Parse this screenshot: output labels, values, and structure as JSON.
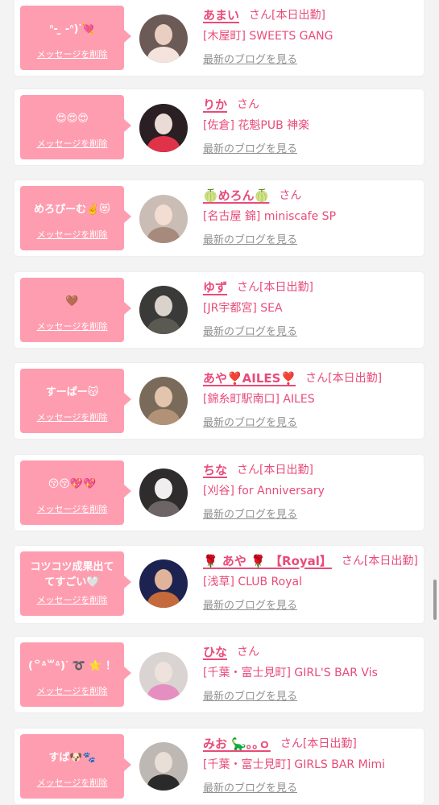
{
  "delete_label": "メッセージを削除",
  "san_label": "さん",
  "blog_label": "最新のブログを見る",
  "colors": {
    "accent": "#e84b7a",
    "bubble": "#ff9db0",
    "link_gray": "#909090"
  },
  "entries": [
    {
      "message": "ᐢ- ̫ -ᐢ)ᐝ💘",
      "name": "あまい",
      "status": "[本日出勤]",
      "shop": "[木屋町] SWEETS GANG",
      "avatar_colors": [
        "#6b5a55",
        "#e9cfc2",
        "#f4e3dc"
      ]
    },
    {
      "message": "😍😍😍",
      "name": "りか",
      "status": "",
      "shop": "[佐倉] 花魁PUB 神楽",
      "avatar_colors": [
        "#2a1f22",
        "#eadbd7",
        "#e0334a"
      ]
    },
    {
      "message": "めろぴーむ✌️😻",
      "name": "🍈めろん🍈",
      "status": "",
      "shop": "[名古屋 錦] miniscafe SP",
      "avatar_colors": [
        "#c9bdb5",
        "#f3dcd2",
        "#a78a7c"
      ]
    },
    {
      "message": "🤎",
      "name": "ゆず",
      "status": "[本日出勤]",
      "shop": "[JR宇都宮] SEA",
      "avatar_colors": [
        "#3a3a38",
        "#d9d3cc",
        "#5b5a52"
      ]
    },
    {
      "message": "すーぱー😽",
      "name": "あや❣️AILES❣️",
      "status": "[本日出勤]",
      "shop": "[錦糸町駅南口] AILES",
      "avatar_colors": [
        "#7a6a5a",
        "#e3c5ae",
        "#b29276"
      ]
    },
    {
      "message": "😚😚💖💖",
      "name": "ちな",
      "status": "[本日出勤]",
      "shop": "[刈谷] for Anniversary",
      "avatar_colors": [
        "#2e2c2c",
        "#f0eeee",
        "#6d6565"
      ]
    },
    {
      "message": "コツコツ成果出て\nてすごい🤍",
      "name": "🌹 あや 🌹 【Royal】",
      "status": "[本日出勤]",
      "shop": "[浅草] CLUB Royal",
      "avatar_colors": [
        "#1d2350",
        "#e0b49a",
        "#c46a3c"
      ]
    },
    {
      "message": "(꒪ᐞ꒳ᐞ)ᐝ ➰ ⭐️ ！",
      "name": "ひな",
      "status": "",
      "shop": "[千葉・富士見町] GIRL'S BAR Vis",
      "avatar_colors": [
        "#d9d4d2",
        "#efe2dc",
        "#e58fc0"
      ]
    },
    {
      "message": "すば🐶🐾",
      "name": "みお 🦕｡｡ｏ",
      "status": "[本日出勤]",
      "shop": "[千葉・富士見町] GIRLS BAR Mimi",
      "avatar_colors": [
        "#bdb8b4",
        "#e9dfd7",
        "#2a2a2a"
      ]
    }
  ]
}
